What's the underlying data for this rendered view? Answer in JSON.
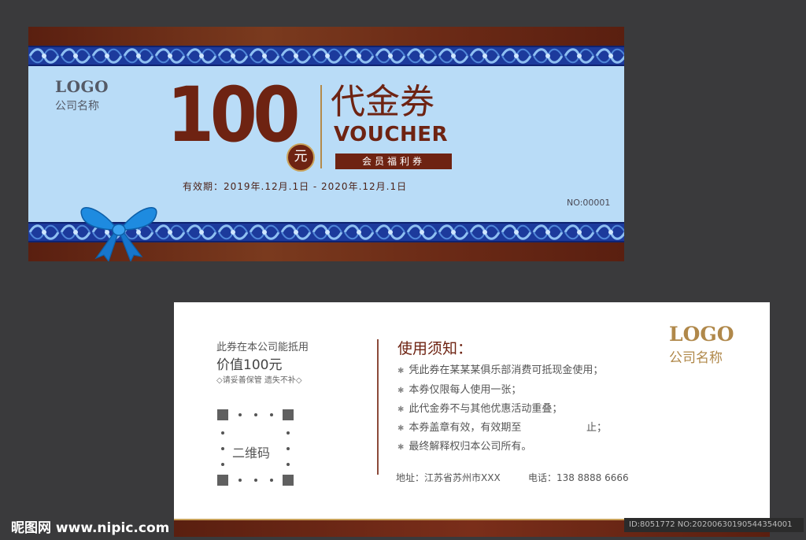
{
  "front": {
    "logo": "LOGO",
    "company": "公司名称",
    "amount": "100",
    "unit": "元",
    "title_cn": "代金券",
    "title_en": "VOUCHER",
    "member_label": "会员福利券",
    "validity": "有效期：2019年.12月.1日 - 2020年.12月.1日",
    "serial": "NO:00001"
  },
  "back": {
    "line1": "此券在本公司能抵用",
    "line2": "价值100元",
    "line3": "◇请妥善保管 遗失不补◇",
    "qr_label": "二维码",
    "rules_title": "使用须知：",
    "rules": [
      "凭此券在某某某俱乐部消费可抵现金使用；",
      "本券仅限每人使用一张；",
      "此代金券不与其他优惠活动重叠；",
      "本券盖章有效，有效期至                    止；",
      "最终解释权归本公司所有。"
    ],
    "address": "地址：江苏省苏州市XXX",
    "phone": "电话：138 8888 6666",
    "logo": "LOGO",
    "company": "公司名称"
  },
  "watermark": "昵图网 www.nipic.com",
  "image_id": "ID:8051772 NO:20200630190544354001",
  "colors": {
    "brown": "#6e2312",
    "light_blue": "#b9dcf7",
    "gold": "#b0884a",
    "pattern_blue": "#1f3fa8"
  }
}
